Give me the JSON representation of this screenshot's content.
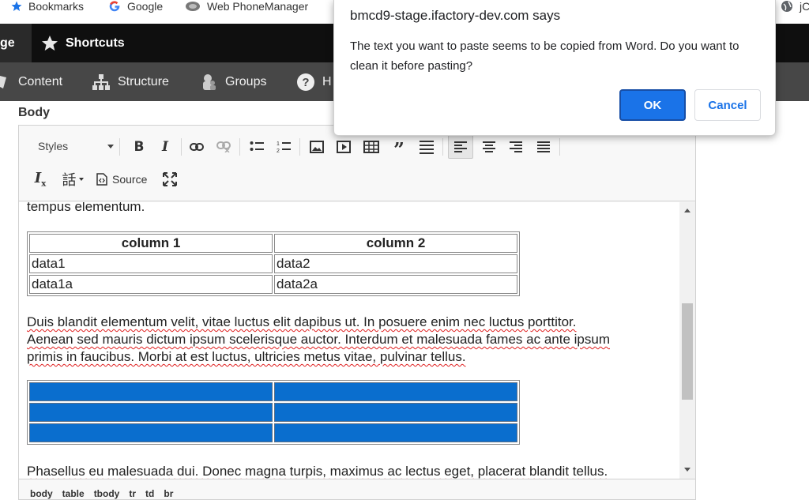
{
  "bookmarks": {
    "items": [
      {
        "label": "Bookmarks",
        "icon": "star-icon"
      },
      {
        "label": "Google",
        "icon": "google-icon"
      },
      {
        "label": "Web PhoneManager",
        "icon": "globe-icon"
      },
      {
        "label": "jC",
        "icon": "globe-icon"
      }
    ]
  },
  "toolbar": {
    "active_tab_label": "ge",
    "shortcuts_label": "Shortcuts",
    "menu": [
      {
        "label": "Content",
        "icon": "content-icon"
      },
      {
        "label": "Structure",
        "icon": "structure-icon"
      },
      {
        "label": "Groups",
        "icon": "groups-icon"
      },
      {
        "label": "H",
        "icon": "help-icon"
      }
    ]
  },
  "form": {
    "body_label": "Body"
  },
  "editor": {
    "styles_label": "Styles",
    "source_label": "Source",
    "paragraph_top_tail": "tempus elementum.",
    "table1": {
      "headers": [
        "column 1",
        "column 2"
      ],
      "rows": [
        [
          "data1",
          "data2"
        ],
        [
          "data1a",
          "data2a"
        ]
      ]
    },
    "paragraph_middle": {
      "line1": "Duis blandit elementum velit, vitae luctus elit dapibus ut. In posuere enim nec luctus porttitor.",
      "line2": "Aenean sed mauris dictum ipsum scelerisque auctor. Interdum et malesuada fames ac ante ipsum",
      "line3": "primis in faucibus. Morbi at est luctus, ultricies metus vitae, pulvinar tellus."
    },
    "paragraph_bottom": "Phasellus eu malesuada dui. Donec magna turpis, maximus ac lectus eget, placerat blandit tellus.",
    "path": [
      "body",
      "table",
      "tbody",
      "tr",
      "td",
      "br"
    ],
    "table2_fill": "#0a6ece"
  },
  "dialog": {
    "title": "bmcd9-stage.ifactory-dev.com says",
    "message": "The text you want to paste seems to be copied from Word. Do you want to clean it before pasting?",
    "ok_label": "OK",
    "cancel_label": "Cancel",
    "accent": "#1a73e8"
  }
}
